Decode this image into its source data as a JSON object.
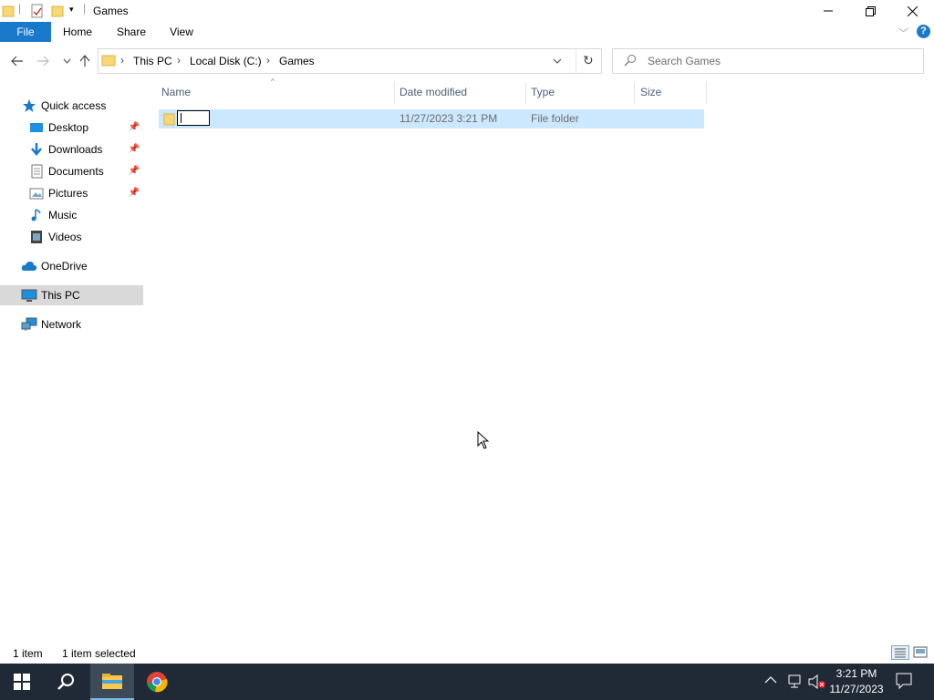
{
  "window": {
    "title": "Games"
  },
  "ribbon": {
    "tabs": [
      "File",
      "Home",
      "Share",
      "View"
    ]
  },
  "address": {
    "crumbs": [
      "This PC",
      "Local Disk (C:)",
      "Games"
    ]
  },
  "search": {
    "placeholder": "Search Games"
  },
  "nav": {
    "quick_access": "Quick access",
    "items": [
      "Desktop",
      "Downloads",
      "Documents",
      "Pictures",
      "Music",
      "Videos"
    ],
    "onedrive": "OneDrive",
    "this_pc": "This PC",
    "network": "Network"
  },
  "columns": {
    "name": "Name",
    "date": "Date modified",
    "type": "Type",
    "size": "Size"
  },
  "rows": [
    {
      "name": "",
      "date": "11/27/2023 3:21 PM",
      "type": "File folder",
      "size": ""
    }
  ],
  "status": {
    "count": "1 item",
    "selected": "1 item selected"
  },
  "taskbar": {
    "time": "3:21 PM",
    "date": "11/27/2023"
  },
  "colors": {
    "accent": "#1979ca",
    "selection": "#cce8ff",
    "folder": "#f8d775",
    "taskbar": "#1f2a36"
  }
}
